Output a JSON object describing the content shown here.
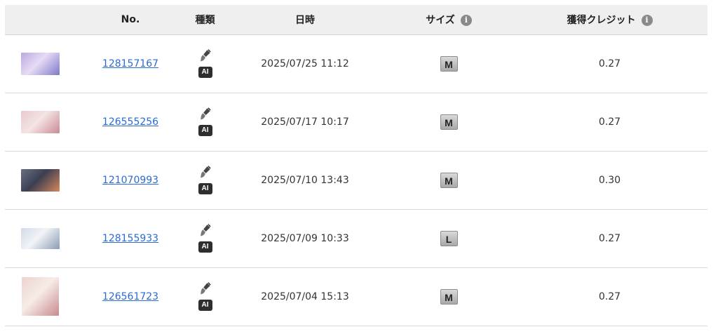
{
  "header": {
    "col_no": "No.",
    "col_type": "種類",
    "col_datetime": "日時",
    "col_size": "サイズ",
    "col_credit": "獲得クレジット",
    "info_glyph": "i"
  },
  "rows": [
    {
      "thumb_colors": [
        "#b9a8e0",
        "#7d79c8",
        "#e7dcf5"
      ],
      "number": "128157167",
      "type_badge": "AI",
      "datetime": "2025/07/25 11:12",
      "size": "M",
      "credit": "0.27"
    },
    {
      "thumb_colors": [
        "#e9c9cc",
        "#c98a93",
        "#f4e4e4"
      ],
      "number": "126555256",
      "type_badge": "AI",
      "datetime": "2025/07/17 10:17",
      "size": "M",
      "credit": "0.27"
    },
    {
      "thumb_colors": [
        "#6a6f82",
        "#d7875a",
        "#3c3f52"
      ],
      "number": "121070993",
      "type_badge": "AI",
      "datetime": "2025/07/10 13:43",
      "size": "M",
      "credit": "0.30"
    },
    {
      "thumb_colors": [
        "#d2dbe8",
        "#8a9cb6",
        "#f1f3f6"
      ],
      "number": "128155933",
      "type_badge": "AI",
      "datetime": "2025/07/09 10:33",
      "size": "L",
      "credit": "0.27"
    },
    {
      "thumb_colors": [
        "#ecd3cf",
        "#c9898f",
        "#f6ece6"
      ],
      "number": "126561723",
      "type_badge": "AI",
      "datetime": "2025/07/04 15:13",
      "size": "M",
      "credit": "0.27"
    }
  ],
  "colors": {
    "header_bg": "#efefef",
    "link": "#2a6bd4",
    "row_border": "#d9d9d9"
  }
}
